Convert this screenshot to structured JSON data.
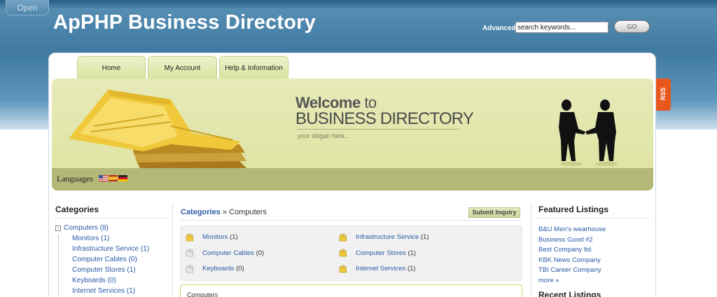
{
  "header": {
    "open_label": "Open",
    "site_title": "ApPHP Business Directory",
    "advanced_label": "Advanced",
    "search_value": "search keywords...",
    "go_label": "GO"
  },
  "tabs": [
    {
      "label": "Home"
    },
    {
      "label": "My Account"
    },
    {
      "label": "Help & Information"
    }
  ],
  "rss_label": "RSS",
  "banner": {
    "welcome": "Welcome",
    "welcome_to": "to",
    "title": "BUSINESS DIRECTORY",
    "slogan": "your slogan here...",
    "languages_label": "Languages"
  },
  "categories": {
    "title": "Categories",
    "items": [
      {
        "label": "Computers (8)"
      },
      {
        "label": "Monitors (1)"
      },
      {
        "label": "Infrastructure Service (1)"
      },
      {
        "label": "Computer Cables (0)"
      },
      {
        "label": "Computer Stores (1)"
      },
      {
        "label": "Keyboards (0)"
      },
      {
        "label": "Internet Services (1)"
      }
    ]
  },
  "main": {
    "breadcrumb_link": "Categories",
    "breadcrumb_sep": "»",
    "breadcrumb_current": "Computers",
    "submit_label": "Submit Inquiry",
    "subcategories": [
      {
        "name": "Monitors",
        "count": "(1)"
      },
      {
        "name": "Computer Cables",
        "count": "(0)"
      },
      {
        "name": "Keyboards",
        "count": "(0)"
      },
      {
        "name": "Infrastructure Service",
        "count": "(1)"
      },
      {
        "name": "Computer Stores",
        "count": "(1)"
      },
      {
        "name": "Internet Services",
        "count": "(1)"
      }
    ],
    "section_title": "Computers"
  },
  "featured": {
    "title": "Featured Listings",
    "items": [
      {
        "label": "B&U Men's wearhouse"
      },
      {
        "label": "Business Good #2"
      },
      {
        "label": "Best Company ltd."
      },
      {
        "label": "KBK News Company"
      },
      {
        "label": "TBI Career Company"
      },
      {
        "label": "more »"
      }
    ]
  },
  "recent_title": "Recent Listings",
  "colors": {
    "link": "#2a5aa6",
    "tab_green": "#d9e39e",
    "rss": "#e8571b"
  }
}
